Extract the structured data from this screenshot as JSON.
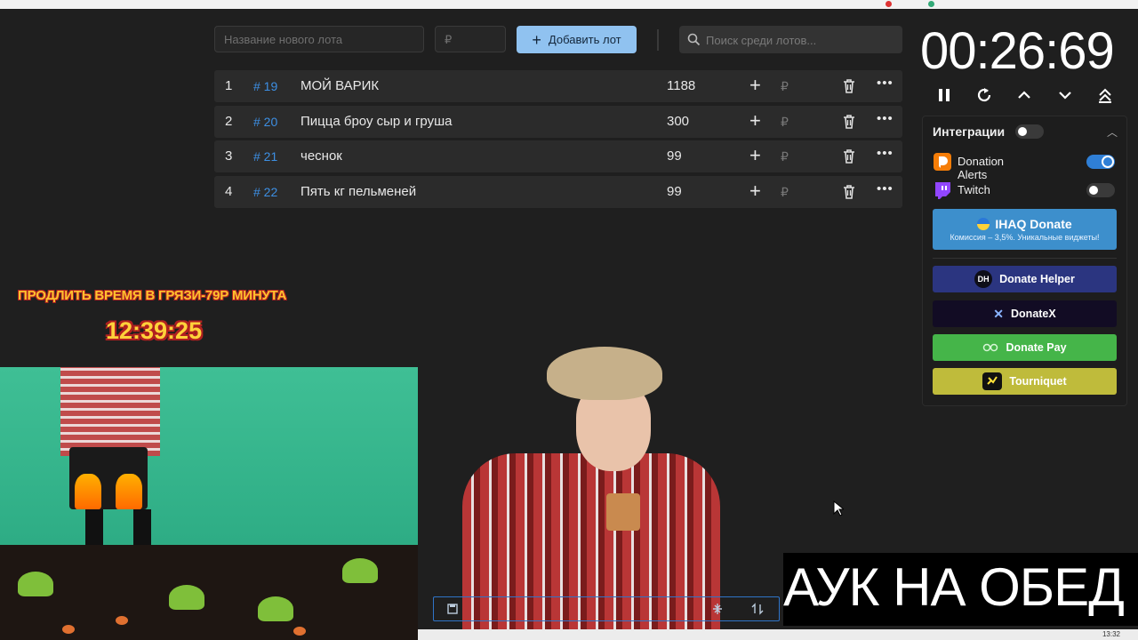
{
  "toolbar": {
    "lot_name_placeholder": "Название нового лота",
    "price_placeholder": "₽",
    "add_label": "Добавить лот",
    "search_placeholder": "Поиск среди лотов..."
  },
  "lots": [
    {
      "index": "1",
      "id": "# 19",
      "name": "МОЙ ВАРИК",
      "amount": "1188",
      "currency": "₽"
    },
    {
      "index": "2",
      "id": "# 20",
      "name": "Пицца броу сыр и груша",
      "amount": "300",
      "currency": "₽"
    },
    {
      "index": "3",
      "id": "# 21",
      "name": "чеснок",
      "amount": "99",
      "currency": "₽"
    },
    {
      "index": "4",
      "id": "# 22",
      "name": "Пять кг пельменей",
      "amount": "99",
      "currency": "₽"
    }
  ],
  "timer": {
    "display": "00:26:69",
    "controls": [
      "pause-icon",
      "restart-icon",
      "chevron-up-icon",
      "chevron-down-icon",
      "double-chevron-up-icon"
    ]
  },
  "integrations": {
    "title": "Интеграции",
    "master_on": false,
    "items": [
      {
        "label": "Donation Alerts",
        "on": true,
        "icon": "donation-alerts-icon"
      },
      {
        "label": "Twitch",
        "on": false,
        "icon": "twitch-icon"
      }
    ],
    "services": {
      "ihaq": {
        "label": "IHAQ Donate",
        "subtitle": "Комиссия – 3,5%. Уникальные виджеты!"
      },
      "donate_helper": {
        "label": "Donate Helper",
        "badge": "DH"
      },
      "donatex": {
        "label": "DonateX",
        "badge": "✕"
      },
      "donate_pay": {
        "label": "Donate Pay"
      },
      "tourniquet": {
        "label": "Tourniquet"
      }
    }
  },
  "overlay": {
    "title": "ПРОДЛИТЬ ВРЕМЯ В ГРЯЗИ-79Р МИНУТА",
    "timer": "12:39:25"
  },
  "banner": {
    "text": "АУК НА ОБЕД"
  },
  "taskbar": {
    "clock": "13:32"
  },
  "colors": {
    "background": "#1f1f1f",
    "accent": "#90c2f0",
    "lot_id": "#3d8fe3",
    "toggle_on": "#2f7fd6",
    "ihaq": "#3d8fcc",
    "donate_helper": "#2b3580",
    "donatex": "#120c24",
    "donate_pay": "#45b549",
    "tourniquet": "#bfbb3b"
  }
}
